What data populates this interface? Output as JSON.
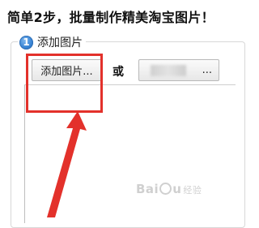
{
  "header": {
    "title": "简单2步，批量制作精美淘宝图片！"
  },
  "panel": {
    "step_number": "1",
    "title": "添加图片",
    "add_button_label": "添加图片...",
    "or_label": "或",
    "second_button_label": "..."
  },
  "annotations": {
    "highlight_color": "#e3312b",
    "arrow_color": "#e3312b"
  },
  "watermark": {
    "text_left": "Bai",
    "text_right": "u",
    "text_sub": "经验"
  }
}
